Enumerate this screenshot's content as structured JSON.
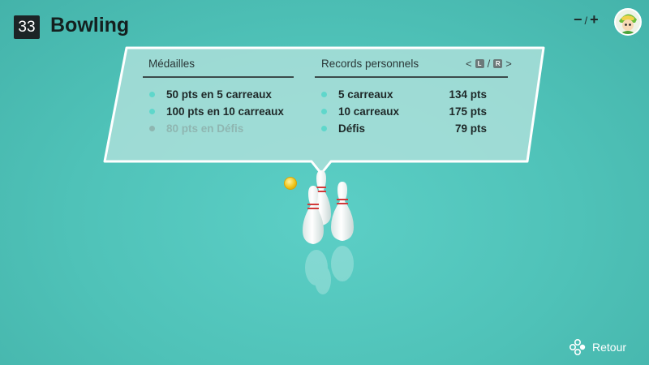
{
  "header": {
    "number": "33",
    "title": "Bowling",
    "zoom_minus": "−",
    "zoom_sep": "/",
    "zoom_plus": "+"
  },
  "medals": {
    "heading": "Médailles",
    "items": [
      {
        "label": "50 pts en 5 carreaux",
        "achieved": true
      },
      {
        "label": "100 pts en 10 carreaux",
        "achieved": true
      },
      {
        "label": "80 pts en Défis",
        "achieved": false
      }
    ]
  },
  "records": {
    "heading": "Records personnels",
    "nav_left": "<",
    "nav_key_l": "L",
    "nav_sep": "/",
    "nav_key_r": "R",
    "nav_right": ">",
    "items": [
      {
        "label": "5 carreaux",
        "value": "134 pts"
      },
      {
        "label": "10 carreaux",
        "value": "175 pts"
      },
      {
        "label": "Défis",
        "value": "79 pts"
      }
    ]
  },
  "footer": {
    "back_label": "Retour",
    "back_icon": "button-cluster-icon"
  },
  "colors": {
    "background": "#4fc2b8",
    "dot_active": "#5fd7cb",
    "dot_inactive": "#8fb6b1",
    "pin_stripe": "#d23a3a"
  }
}
